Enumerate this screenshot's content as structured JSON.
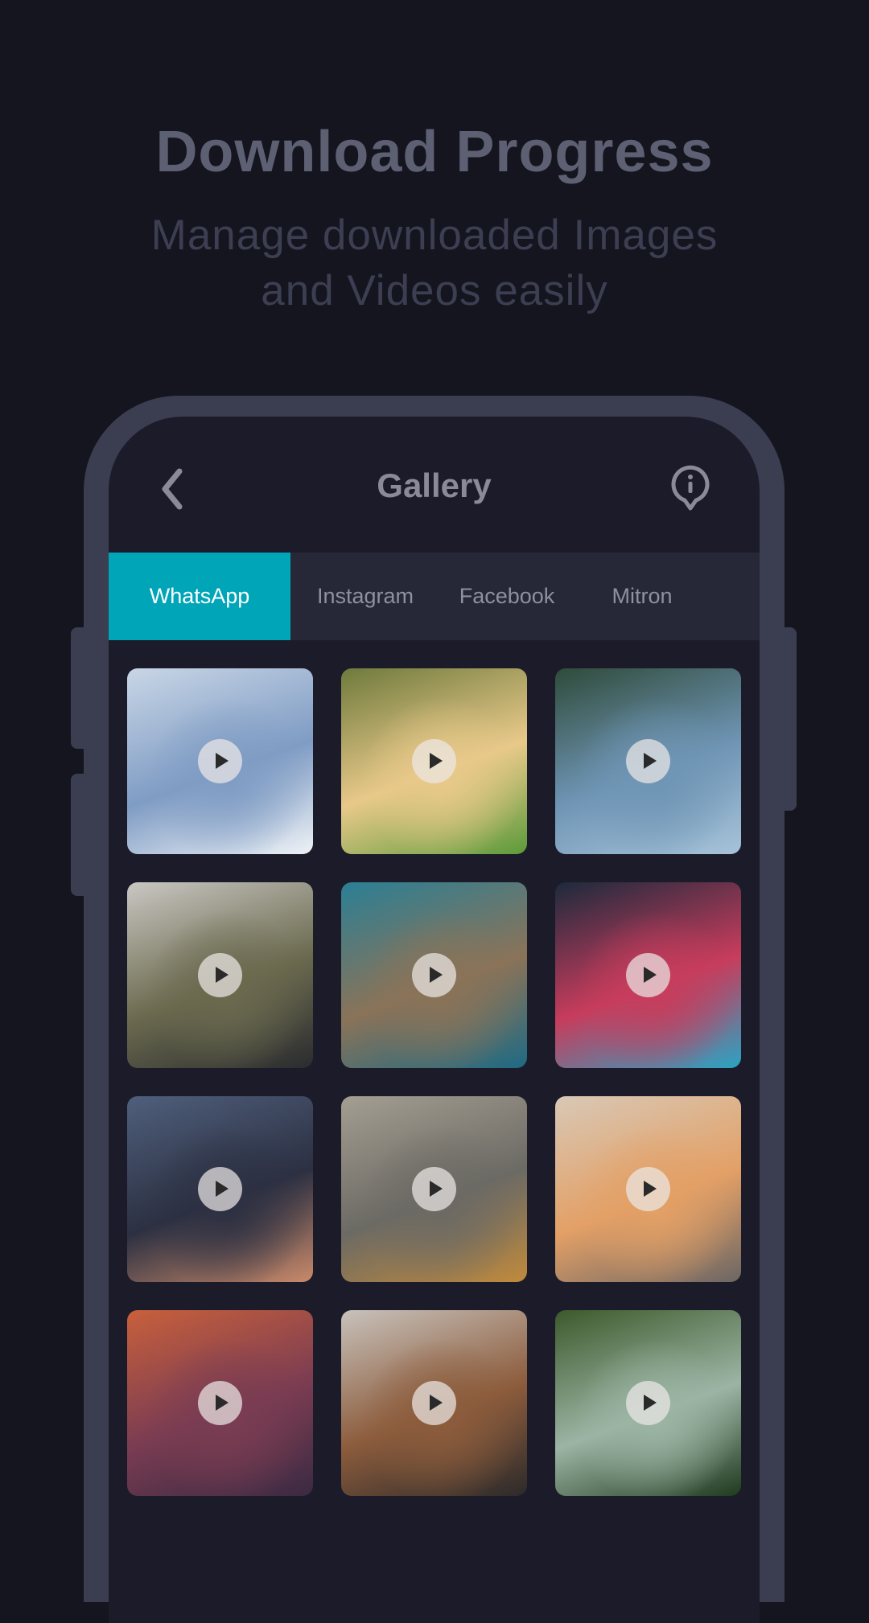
{
  "hero": {
    "title": "Download Progress",
    "subtitle_line1": "Manage downloaded Images",
    "subtitle_line2": "and Videos easily"
  },
  "app": {
    "title": "Gallery",
    "back_icon": "chevron-left-icon",
    "info_icon": "info-icon",
    "tabs": [
      {
        "label": "WhatsApp",
        "active": true
      },
      {
        "label": "Instagram",
        "active": false
      },
      {
        "label": "Facebook",
        "active": false
      },
      {
        "label": "Mitron",
        "active": false
      }
    ],
    "accent_color": "#00a5b8",
    "thumbnails": [
      {
        "type": "video",
        "colors": [
          "#c9d6e6",
          "#7f9cc4",
          "#eef2f6"
        ]
      },
      {
        "type": "video",
        "colors": [
          "#6e7a3c",
          "#e8c98a",
          "#5c9a3a"
        ]
      },
      {
        "type": "video",
        "colors": [
          "#2f4b3a",
          "#6f95b5",
          "#a7c3d9"
        ]
      },
      {
        "type": "video",
        "colors": [
          "#c9c7c2",
          "#6b6a4f",
          "#2a2b2e"
        ]
      },
      {
        "type": "video",
        "colors": [
          "#2b7f95",
          "#8a7358",
          "#1e6a84"
        ]
      },
      {
        "type": "video",
        "colors": [
          "#1c2a3c",
          "#c73c5c",
          "#2aa4c4"
        ]
      },
      {
        "type": "video",
        "colors": [
          "#4f5f7c",
          "#2c3042",
          "#c98a6a"
        ]
      },
      {
        "type": "video",
        "colors": [
          "#a49e92",
          "#6c6a64",
          "#c08a3c"
        ]
      },
      {
        "type": "video",
        "colors": [
          "#d8c8b6",
          "#e3a066",
          "#6c6664"
        ]
      },
      {
        "type": "video",
        "colors": [
          "#c8603c",
          "#7a3c52",
          "#3a2a42"
        ]
      },
      {
        "type": "video",
        "colors": [
          "#c8c2bc",
          "#8c5c3c",
          "#2c2a2a"
        ]
      },
      {
        "type": "video",
        "colors": [
          "#3c5a2c",
          "#9cb4a4",
          "#1e3a1e"
        ]
      }
    ]
  }
}
